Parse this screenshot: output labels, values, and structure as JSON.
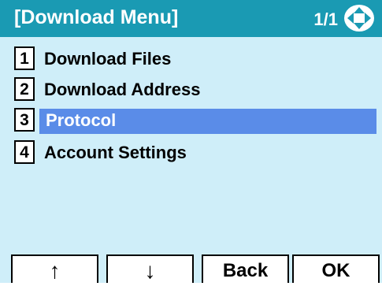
{
  "header": {
    "title": "[Download Menu]",
    "page_indicator": "1/1",
    "nav_icon": "up-down-left-right-arrows-icon"
  },
  "menu": {
    "items": [
      {
        "number": "1",
        "label": "Download Files",
        "selected": false
      },
      {
        "number": "2",
        "label": "Download Address",
        "selected": false
      },
      {
        "number": "3",
        "label": "Protocol",
        "selected": true
      },
      {
        "number": "4",
        "label": "Account Settings",
        "selected": false
      }
    ]
  },
  "softkeys": [
    {
      "label": "↑"
    },
    {
      "label": "↓"
    },
    {
      "label": "Back"
    },
    {
      "label": "OK"
    }
  ],
  "colors": {
    "title_bar": "#1a9ab3",
    "background": "#cfeef9",
    "selection": "#5a8ce8"
  }
}
